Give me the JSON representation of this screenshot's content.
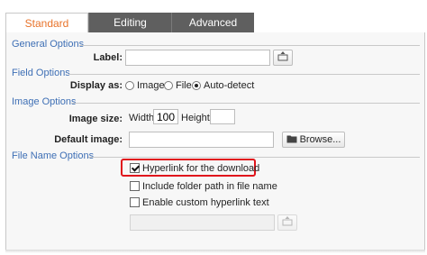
{
  "tabs": [
    {
      "label": "Standard",
      "active": true
    },
    {
      "label": "Editing",
      "active": false
    },
    {
      "label": "Advanced",
      "active": false
    }
  ],
  "sections": {
    "general": "General Options",
    "field": "Field Options",
    "image": "Image Options",
    "file_name": "File Name Options"
  },
  "general": {
    "label_caption": "Label:",
    "label_value": ""
  },
  "field": {
    "display_as_caption": "Display as:",
    "options": [
      {
        "label": "Image",
        "checked": false
      },
      {
        "label": "File",
        "checked": false
      },
      {
        "label": "Auto-detect",
        "checked": true
      }
    ]
  },
  "image": {
    "size_caption": "Image size:",
    "width_label": "Width:",
    "width_value": "100",
    "height_label": "Height:",
    "height_value": "",
    "default_caption": "Default image:",
    "default_value": "",
    "browse_label": "Browse..."
  },
  "file_name": {
    "checkboxes": [
      {
        "label": "Hyperlink for the download",
        "checked": true,
        "highlighted": true
      },
      {
        "label": "Include folder path in file name",
        "checked": false
      },
      {
        "label": "Enable custom hyperlink text",
        "checked": false
      }
    ],
    "custom_text_value": ""
  },
  "colors": {
    "active_tab_text": "#e8732a",
    "inactive_tab_bg": "#5f5f5f",
    "section_header": "#3e6fb5",
    "highlight_border": "#e0151c"
  },
  "icons": [
    "insert-field-icon",
    "folder-icon"
  ]
}
